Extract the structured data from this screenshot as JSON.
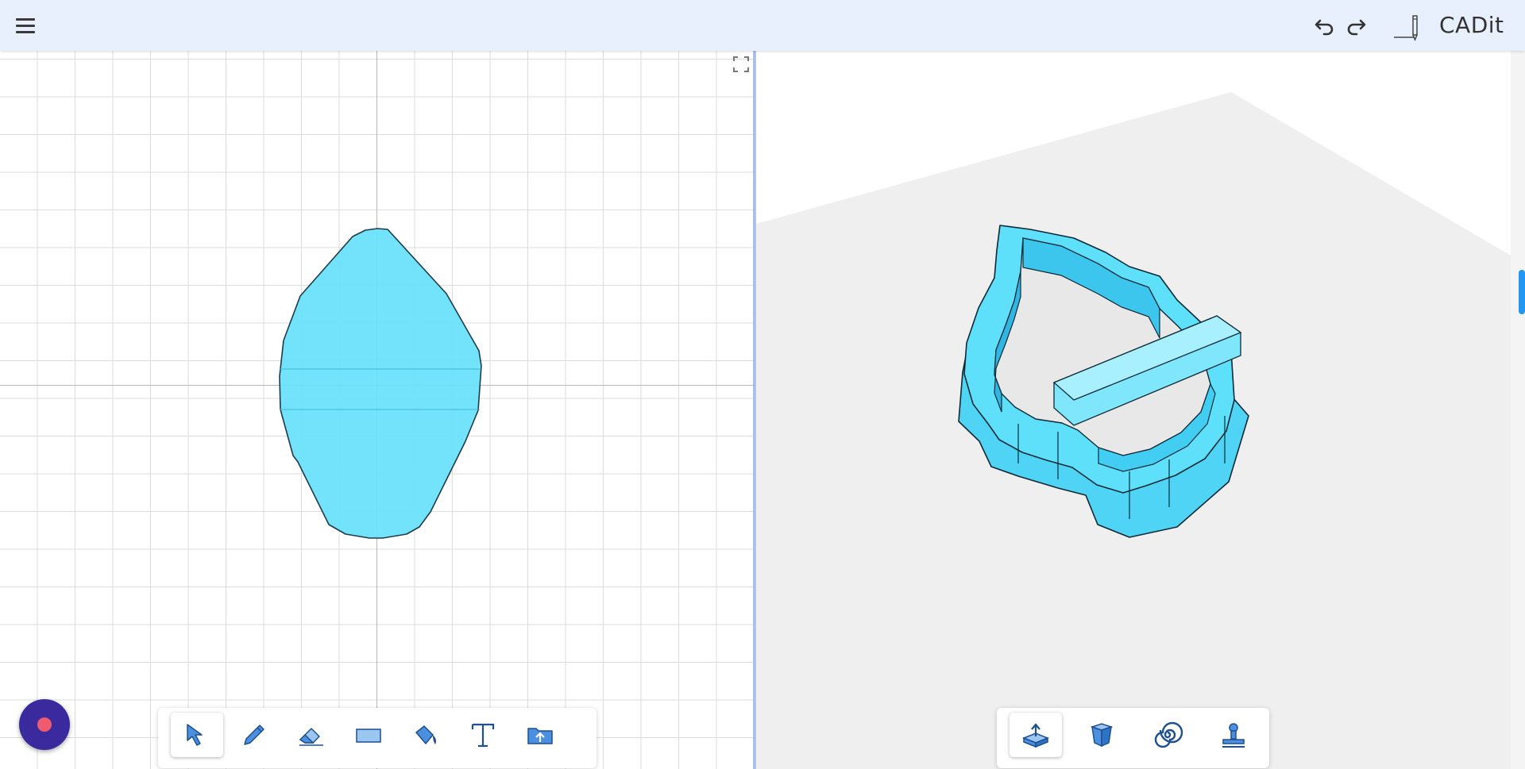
{
  "app": {
    "title": "CADit"
  },
  "icons": {
    "menu": "menu-icon",
    "undo": "undo-icon",
    "redo": "redo-icon",
    "logo": "pencil-logo-icon",
    "expand": "fullscreen-icon"
  },
  "sketch_toolbar": {
    "tools": [
      "select",
      "pencil",
      "eraser",
      "rectangle",
      "fill",
      "text",
      "import"
    ],
    "active": "select"
  },
  "model_toolbar": {
    "tools": [
      "extrude",
      "box",
      "spiral",
      "stamp"
    ],
    "active": "extrude"
  },
  "colors": {
    "topbar": "#e8f0fd",
    "shape_fill": "#66e1fb",
    "accent": "#2196f3",
    "record_button": "#3b2a9e",
    "record_dot": "#f05a6e"
  }
}
